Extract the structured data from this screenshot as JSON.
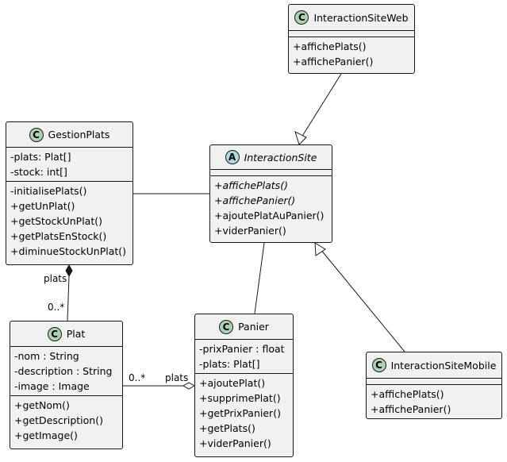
{
  "colors": {
    "class_badge": "#add1b2",
    "abstract_badge": "#a9dcdf",
    "box_fill": "#f1f1f1",
    "border": "#181818"
  },
  "classes": [
    {
      "id": "InteractionSiteWeb",
      "kind": "class",
      "badge": "C",
      "name": "InteractionSiteWeb",
      "attributes": [],
      "methods": [
        {
          "text": "+affichePlats()"
        },
        {
          "text": "+affichePanier()"
        }
      ]
    },
    {
      "id": "GestionPlats",
      "kind": "class",
      "badge": "C",
      "name": "GestionPlats",
      "attributes": [
        {
          "text": "-plats: Plat[]"
        },
        {
          "text": "-stock: int[]"
        }
      ],
      "methods": [
        {
          "text": "-initialisePlats()"
        },
        {
          "text": "+getUnPlat()"
        },
        {
          "text": "+getStockUnPlat()"
        },
        {
          "text": "+getPlatsEnStock()"
        },
        {
          "text": "+diminueStockUnPlat()"
        }
      ]
    },
    {
      "id": "InteractionSite",
      "kind": "abstract",
      "badge": "A",
      "name": "InteractionSite",
      "attributes": [],
      "methods": [
        {
          "text": "+affichePlats()",
          "abstract": true
        },
        {
          "text": "+affichePanier()",
          "abstract": true
        },
        {
          "text": "+ajoutePlatAuPanier()"
        },
        {
          "text": "+viderPanier()"
        }
      ]
    },
    {
      "id": "Plat",
      "kind": "class",
      "badge": "C",
      "name": "Plat",
      "attributes": [
        {
          "text": "-nom : String"
        },
        {
          "text": "-description : String"
        },
        {
          "text": "-image : Image"
        }
      ],
      "methods": [
        {
          "text": "+getNom()"
        },
        {
          "text": "+getDescription()"
        },
        {
          "text": "+getImage()"
        }
      ]
    },
    {
      "id": "Panier",
      "kind": "class",
      "badge": "C",
      "name": "Panier",
      "attributes": [
        {
          "text": "-prixPanier : float"
        },
        {
          "text": "-plats: Plat[]"
        }
      ],
      "methods": [
        {
          "text": "+ajoutePlat()"
        },
        {
          "text": "+supprimePlat()"
        },
        {
          "text": "+getPrixPanier()"
        },
        {
          "text": "+getPlats()"
        },
        {
          "text": "+viderPanier()"
        }
      ]
    },
    {
      "id": "InteractionSiteMobile",
      "kind": "class",
      "badge": "C",
      "name": "InteractionSiteMobile",
      "attributes": [],
      "methods": [
        {
          "text": "+affichePlats()"
        },
        {
          "text": "+affichePanier()"
        }
      ]
    }
  ],
  "relations": [
    {
      "type": "generalization",
      "from": "InteractionSiteWeb",
      "to": "InteractionSite"
    },
    {
      "type": "generalization",
      "from": "InteractionSiteMobile",
      "to": "InteractionSite"
    },
    {
      "type": "association",
      "from": "GestionPlats",
      "to": "InteractionSite"
    },
    {
      "type": "association",
      "from": "InteractionSite",
      "to": "Panier"
    },
    {
      "type": "composition",
      "from": "GestionPlats",
      "to": "Plat",
      "from_label": "plats",
      "to_label": "0..*"
    },
    {
      "type": "aggregation",
      "from": "Panier",
      "to": "Plat",
      "from_label": "plats",
      "to_label": "0..*"
    }
  ]
}
